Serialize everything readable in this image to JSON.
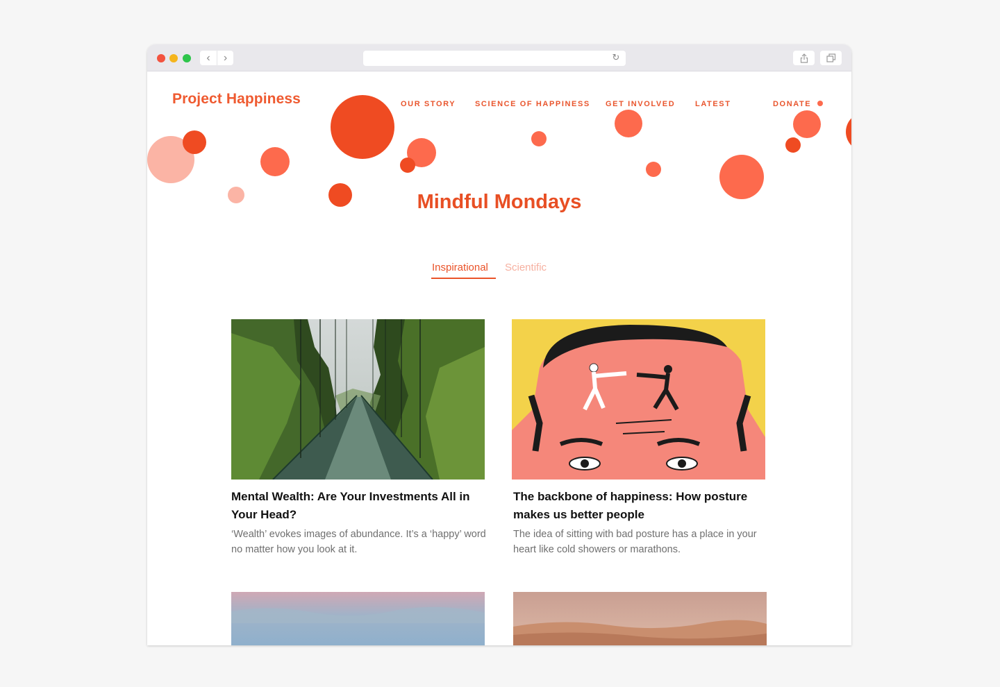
{
  "site": {
    "logo": "Project Happiness",
    "nav": [
      "OUR STORY",
      "SCIENCE OF HAPPINESS",
      "GET INVOLVED",
      "LATEST",
      "DONATE"
    ]
  },
  "page": {
    "title": "Mindful Mondays",
    "tabs": [
      "Inspirational",
      "Scientific"
    ],
    "active_tab": "Inspirational"
  },
  "articles": [
    {
      "title": "Mental Wealth: Are Your Investments All in Your Head?",
      "excerpt": "‘Wealth’ evokes images of abundance. It’s a ‘happy’ word no matter how you look at it."
    },
    {
      "title": "The backbone of happiness: How posture makes us better people",
      "excerpt": "The idea of sitting with bad posture has a place in your heart like cold showers or marathons."
    }
  ],
  "colors": {
    "accent": "#e9552d",
    "accent_light": "#f6b0a0",
    "bubble_dark": "#ef4b22",
    "bubble_mid": "#fd6a4d",
    "bubble_pale": "#fbb4a5"
  }
}
